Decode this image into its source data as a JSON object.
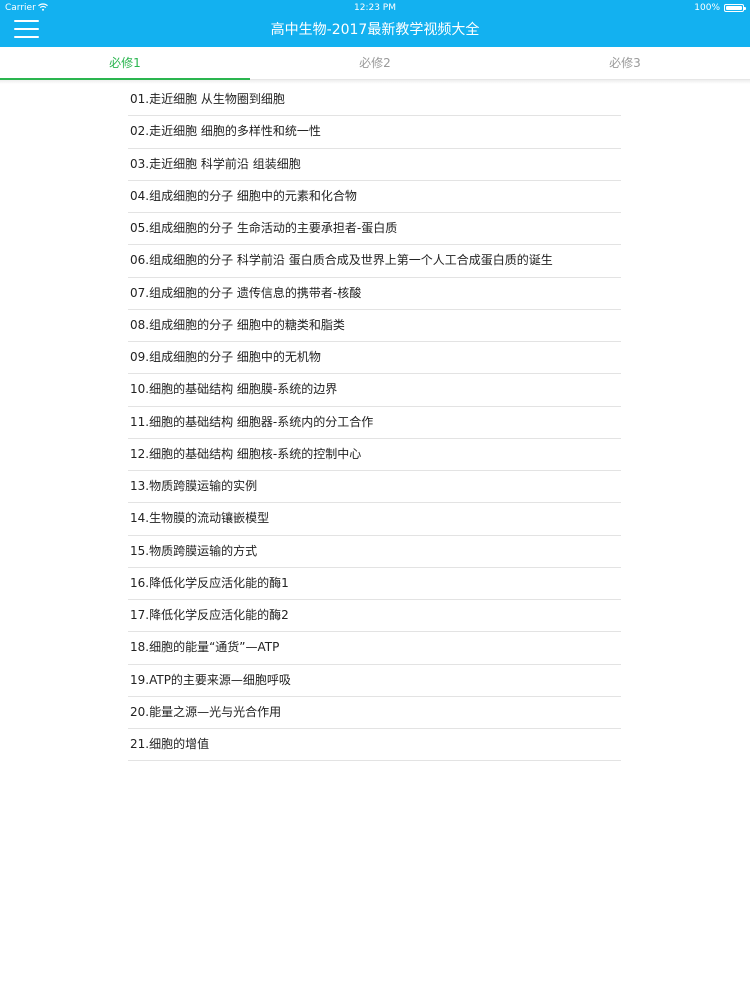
{
  "status_bar": {
    "carrier": "Carrier",
    "time": "12:23 PM",
    "battery": "100%"
  },
  "header": {
    "title": "高中生物-2017最新教学视频大全",
    "menu_icon": "hamburger-menu-icon",
    "background_color": "#13b1f0"
  },
  "tabs": [
    {
      "label": "必修1",
      "active": true
    },
    {
      "label": "必修2",
      "active": false
    },
    {
      "label": "必修3",
      "active": false
    }
  ],
  "accent_color": "#2ab54f",
  "lessons": [
    "01.走近细胞 从生物圈到细胞",
    "02.走近细胞 细胞的多样性和统一性",
    "03.走近细胞 科学前沿 组装细胞",
    "04.组成细胞的分子 细胞中的元素和化合物",
    "05.组成细胞的分子 生命活动的主要承担者-蛋白质",
    "06.组成细胞的分子 科学前沿 蛋白质合成及世界上第一个人工合成蛋白质的诞生",
    "07.组成细胞的分子 遗传信息的携带者-核酸",
    "08.组成细胞的分子 细胞中的糖类和脂类",
    "09.组成细胞的分子 细胞中的无机物",
    "10.细胞的基础结构 细胞膜-系统的边界",
    "11.细胞的基础结构 细胞器-系统内的分工合作",
    "12.细胞的基础结构 细胞核-系统的控制中心",
    "13.物质跨膜运输的实例",
    "14.生物膜的流动镶嵌模型",
    "15.物质跨膜运输的方式",
    "16.降低化学反应活化能的酶1",
    "17.降低化学反应活化能的酶2",
    "18.细胞的能量“通货”—ATP",
    "19.ATP的主要来源—细胞呼吸",
    "20.能量之源—光与光合作用",
    "21.细胞的增值"
  ]
}
